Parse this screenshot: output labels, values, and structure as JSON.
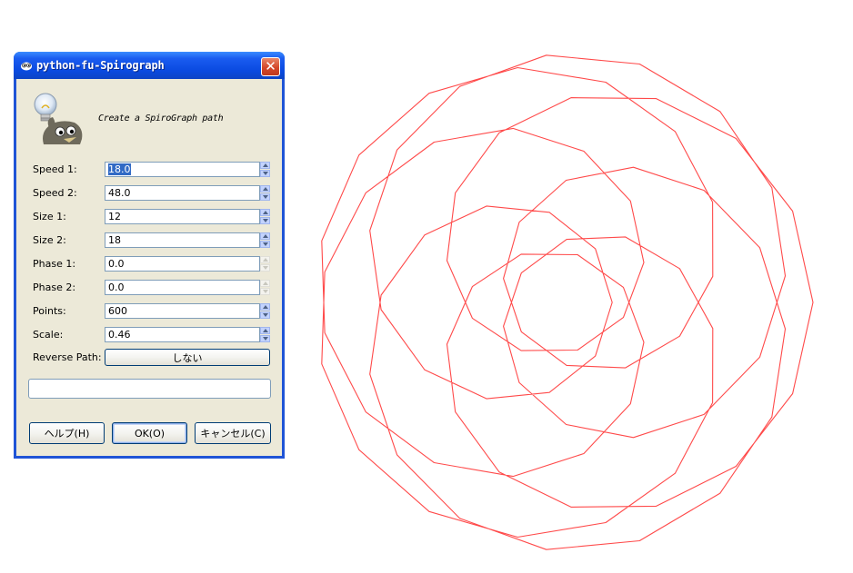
{
  "window": {
    "title": "python-fu-Spirograph",
    "close_glyph": "✕"
  },
  "header": {
    "icon": "gimp-wilber-lightbulb-icon",
    "description": "Create a SpiroGraph path"
  },
  "fields": [
    {
      "label": "Speed 1:",
      "value": "18.0",
      "selected": true,
      "spin_enabled": true
    },
    {
      "label": "Speed 2:",
      "value": "48.0",
      "selected": false,
      "spin_enabled": true
    },
    {
      "label": "Size 1:",
      "value": "12",
      "selected": false,
      "spin_enabled": true
    },
    {
      "label": "Size 2:",
      "value": "18",
      "selected": false,
      "spin_enabled": true
    },
    {
      "label": "Phase 1:",
      "value": "0.0",
      "selected": false,
      "spin_enabled": false
    },
    {
      "label": "Phase 2:",
      "value": "0.0",
      "selected": false,
      "spin_enabled": false
    },
    {
      "label": "Points:",
      "value": "600",
      "selected": false,
      "spin_enabled": true
    },
    {
      "label": "Scale:",
      "value": "0.46",
      "selected": false,
      "spin_enabled": true
    }
  ],
  "reverse_path": {
    "label": "Reverse Path:",
    "value": "しない"
  },
  "buttons": {
    "help": "ヘルプ(H)",
    "ok": "OK(O)",
    "cancel": "キャンセル(C)"
  },
  "spirograph": {
    "stroke_color": "#ff4a4a",
    "speed1": 18.0,
    "speed2": 48.0,
    "size1": 12,
    "size2": 18,
    "phase1": 0.0,
    "phase2": 0.0,
    "points": 600,
    "scale": 0.46
  },
  "colors": {
    "titlebar_blue": "#0a4ae0",
    "dialog_face": "#ece9d8",
    "selection": "#316ac5",
    "close_red": "#d5482a"
  }
}
